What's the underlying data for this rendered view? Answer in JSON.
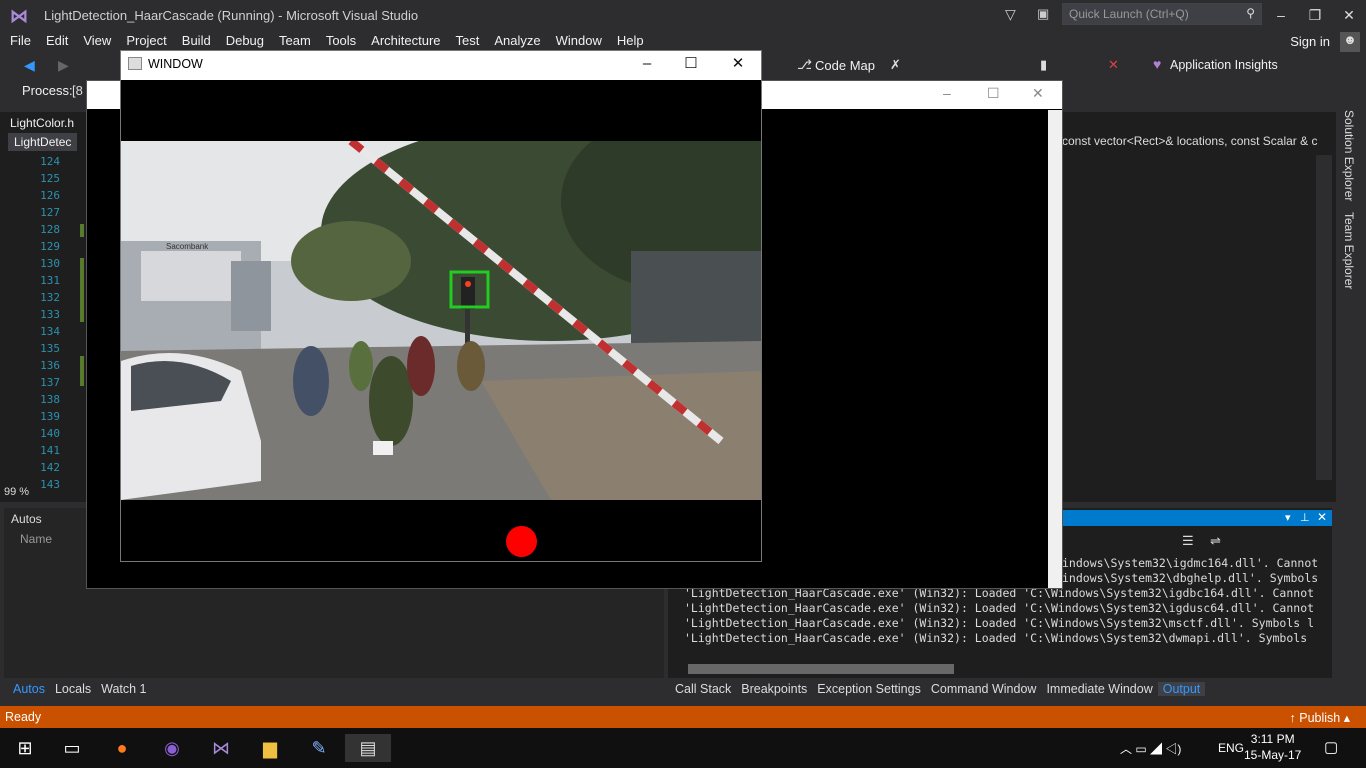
{
  "vs": {
    "window_title": "LightDetection_HaarCascade (Running) - Microsoft Visual Studio",
    "quick_launch_placeholder": "Quick Launch (Ctrl+Q)",
    "sign_in": "Sign in",
    "menu": [
      "File",
      "Edit",
      "View",
      "Project",
      "Build",
      "Debug",
      "Team",
      "Tools",
      "Architecture",
      "Test",
      "Analyze",
      "Window",
      "Help"
    ],
    "toolbar": {
      "code_map": "Code Map",
      "app_insights": "Application Insights"
    },
    "process_label": "Process:",
    "process_value": "[8",
    "tab_file1": "LightColor.h",
    "tab_file2": "LightDetec",
    "line_numbers": [
      "124",
      "125",
      "126",
      "127",
      "128",
      "129",
      "130",
      "131",
      "132",
      "133",
      "134",
      "135",
      "136",
      "137",
      "138",
      "139",
      "140",
      "141",
      "142",
      "143"
    ],
    "code_signature": "const vector<Rect>& locations, const Scalar & c",
    "zoom": "99 %",
    "autos_title": "Autos",
    "autos_col_name": "Name",
    "output_lines": [
      "indows\\System32\\igdmc164.dll'. Cannot",
      "indows\\System32\\dbghelp.dll'. Symbols",
      "'LightDetection_HaarCascade.exe' (Win32): Loaded 'C:\\Windows\\System32\\igdbc164.dll'. Cannot",
      "'LightDetection_HaarCascade.exe' (Win32): Loaded 'C:\\Windows\\System32\\igdusc64.dll'. Cannot",
      "'LightDetection_HaarCascade.exe' (Win32): Loaded 'C:\\Windows\\System32\\msctf.dll'. Symbols l",
      "'LightDetection_HaarCascade.exe' (Win32): Loaded 'C:\\Windows\\System32\\dwmapi.dll'. Symbols"
    ],
    "bottom_tabs_left": [
      "Autos",
      "Locals",
      "Watch 1"
    ],
    "bottom_tabs_right": [
      "Call Stack",
      "Breakpoints",
      "Exception Settings",
      "Command Window",
      "Immediate Window",
      "Output"
    ],
    "status": "Ready",
    "publish": "Publish",
    "solution_explorer": "Solution Explorer",
    "team_explorer": "Team Explorer"
  },
  "opencv_window": {
    "title": "WINDOW",
    "detected_light_color": "#ff0000",
    "detection_box_color": "#22cc22",
    "sign_text": "Sacombank"
  },
  "taskbar": {
    "lang": "ENG",
    "time": "3:11 PM",
    "date": "15-May-17"
  },
  "colors": {
    "accent": "#007acc",
    "status_bar": "#ca5100"
  }
}
